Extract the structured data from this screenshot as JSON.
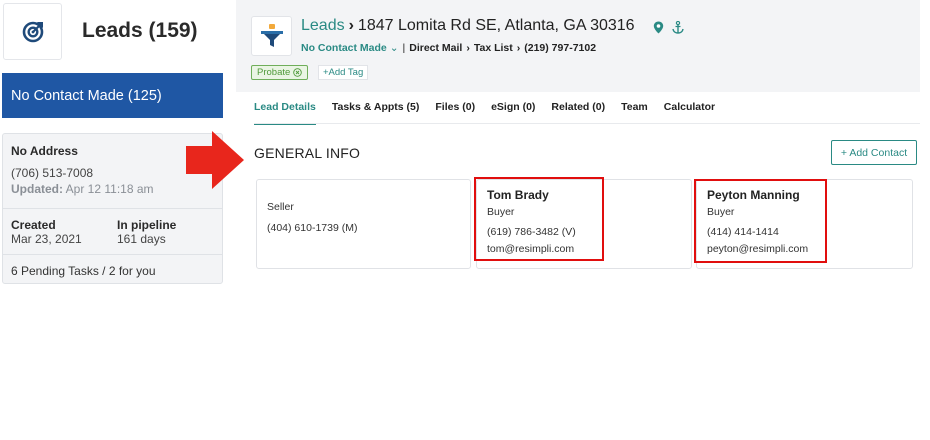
{
  "sidebar": {
    "title": "Leads (159)",
    "status": "No Contact Made (125)",
    "no_address": "No Address",
    "phone": "(706) 513-7008",
    "updated_label": "Updated:",
    "updated_value": "Apr 12 11:18 am",
    "created_label": "Created",
    "created_value": "Mar 23, 2021",
    "pipeline_label": "In pipeline",
    "pipeline_value": "161 days",
    "tasks_text": "6 Pending Tasks / 2 for you"
  },
  "header": {
    "leads_link": "Leads",
    "address": "1847 Lomita Rd SE, Atlanta, GA 30316",
    "status_select": "No Contact Made",
    "source": "Direct Mail",
    "list": "Tax List",
    "phone": "(219) 797-7102",
    "tag": "Probate",
    "add_tag": "+Add Tag"
  },
  "tabs": [
    {
      "label": "Lead Details",
      "active": true
    },
    {
      "label": "Tasks & Appts (5)"
    },
    {
      "label": "Files (0)"
    },
    {
      "label": "eSign (0)"
    },
    {
      "label": "Related (0)"
    },
    {
      "label": "Team"
    },
    {
      "label": "Calculator"
    }
  ],
  "general_info": {
    "heading": "GENERAL INFO",
    "add_contact": "+ Add Contact"
  },
  "contacts": [
    {
      "name": "",
      "role": "Seller",
      "phone": "(404) 610-1739  (M)",
      "email": ""
    },
    {
      "name": "Tom Brady",
      "role": "Buyer",
      "phone": "(619) 786-3482  (V)",
      "email": "tom@resimpli.com"
    },
    {
      "name": "Peyton Manning",
      "role": "Buyer",
      "phone": "(414) 414-1414",
      "email": "peyton@resimpli.com"
    }
  ],
  "colors": {
    "accent": "#2a8a84",
    "status_bar": "#1f57a4",
    "highlight": "#e10e0e"
  },
  "icons": [
    "target-icon",
    "funnel-icon",
    "location-pin-icon",
    "anchor-icon",
    "chevron-down-icon",
    "close-circle-icon",
    "right-arrow-icon"
  ]
}
